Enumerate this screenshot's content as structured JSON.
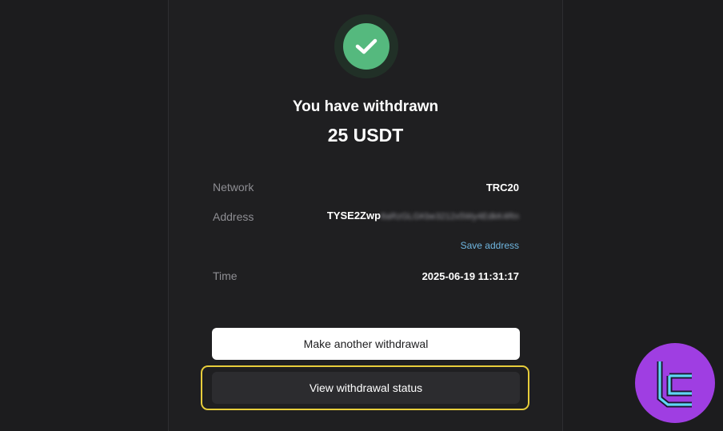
{
  "result": {
    "title": "You have withdrawn",
    "amount": "25 USDT"
  },
  "details": {
    "network_label": "Network",
    "network_value": "TRC20",
    "address_label": "Address",
    "address_visible": "TYSE2Zwp",
    "address_masked": "8aRzGLGKbe3212x5Wy4EdkK4Rn",
    "save_address_label": "Save address",
    "time_label": "Time",
    "time_value": "2025-06-19 11:31:17"
  },
  "actions": {
    "make_another_label": "Make another withdrawal",
    "view_status_label": "View withdrawal status"
  },
  "colors": {
    "success": "#55b97e",
    "highlight": "#e7cd3b",
    "link": "#6fb6e0",
    "logo_bg": "#9f3ee2",
    "logo_fg": "#5fd6f5"
  },
  "icons": {
    "success": "check-icon",
    "watermark": "brand-logo-icon"
  }
}
